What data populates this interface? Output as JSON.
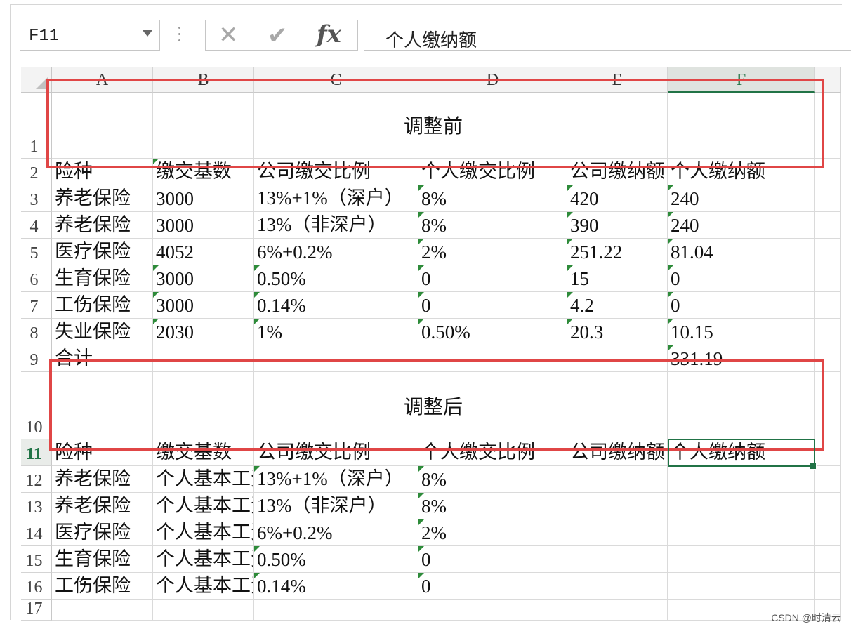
{
  "formula_bar": {
    "name_box": "F11",
    "cancel_icon": "✕",
    "enter_icon": "✔",
    "function_icon": "fx",
    "formula_text": "个人缴纳额"
  },
  "columns": [
    "A",
    "B",
    "C",
    "D",
    "E",
    "F"
  ],
  "selected_column": "F",
  "sections": {
    "before_title": "调整前",
    "after_title": "调整后"
  },
  "rows": [
    {
      "num": "1",
      "cells": [
        "",
        "",
        "",
        "",
        "",
        ""
      ]
    },
    {
      "num": "2",
      "cells": [
        "险种",
        "缴交基数",
        "公司缴交比例",
        "个人缴交比例",
        "公司缴纳额",
        "个人缴纳额"
      ]
    },
    {
      "num": "3",
      "cells": [
        "养老保险",
        "3000",
        "13%+1%（深户）",
        "8%",
        "420",
        "240"
      ]
    },
    {
      "num": "4",
      "cells": [
        "养老保险",
        "3000",
        "13%（非深户）",
        "8%",
        "390",
        "240"
      ]
    },
    {
      "num": "5",
      "cells": [
        "医疗保险",
        "4052",
        "6%+0.2%",
        "2%",
        "251.22",
        "81.04"
      ]
    },
    {
      "num": "6",
      "cells": [
        "生育保险",
        "3000",
        "0.50%",
        "0",
        "15",
        "0"
      ]
    },
    {
      "num": "7",
      "cells": [
        "工伤保险",
        "3000",
        "0.14%",
        "0",
        "4.2",
        "0"
      ]
    },
    {
      "num": "8",
      "cells": [
        "失业保险",
        "2030",
        "1%",
        "0.50%",
        "20.3",
        "10.15"
      ]
    },
    {
      "num": "9",
      "cells": [
        "合计",
        "",
        "",
        "",
        "",
        "331.19"
      ]
    },
    {
      "num": "10",
      "cells": [
        "",
        "",
        "",
        "",
        "",
        ""
      ]
    },
    {
      "num": "11",
      "cells": [
        "险种",
        "缴交基数",
        "公司缴交比例",
        "个人缴交比例",
        "公司缴纳额",
        "个人缴纳额"
      ]
    },
    {
      "num": "12",
      "cells": [
        "养老保险",
        "个人基本工资",
        "13%+1%（深户）",
        "8%",
        "",
        ""
      ]
    },
    {
      "num": "13",
      "cells": [
        "养老保险",
        "个人基本工资",
        "13%（非深户）",
        "8%",
        "",
        ""
      ]
    },
    {
      "num": "14",
      "cells": [
        "医疗保险",
        "个人基本工资",
        "6%+0.2%",
        "2%",
        "",
        ""
      ]
    },
    {
      "num": "15",
      "cells": [
        "生育保险",
        "个人基本工资",
        "0.50%",
        "0",
        "",
        ""
      ]
    },
    {
      "num": "16",
      "cells": [
        "工伤保险",
        "个人基本工资",
        "0.14%",
        "0",
        "",
        ""
      ]
    },
    {
      "num": "17",
      "cells": [
        "",
        "",
        "",
        "",
        "",
        ""
      ]
    }
  ],
  "watermark": "CSDN @时清云",
  "colors": {
    "accent": "#217346",
    "annotation_red": "#e04646"
  }
}
